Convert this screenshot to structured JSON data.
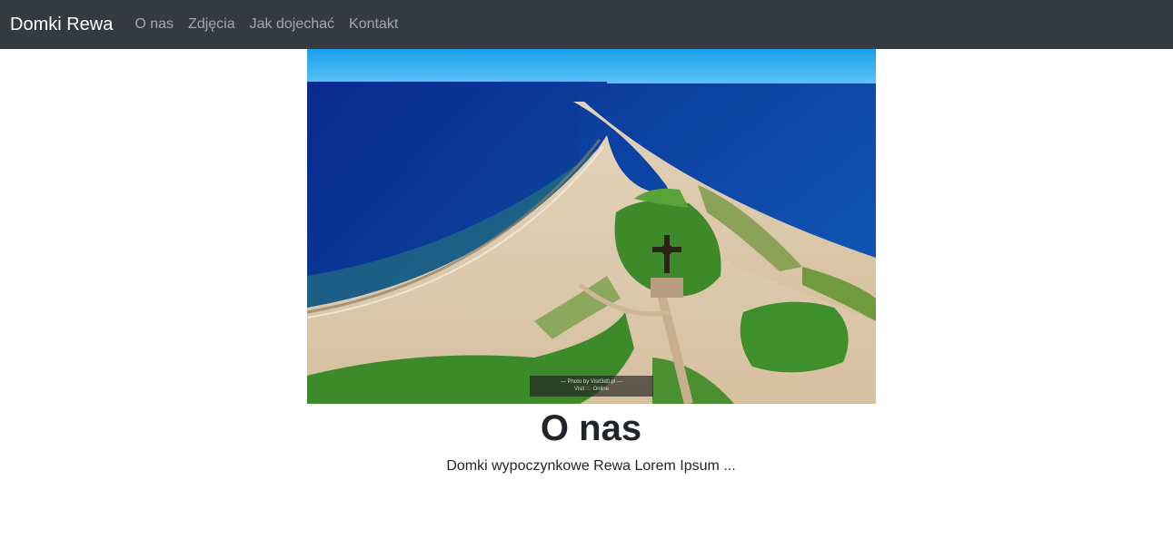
{
  "navbar": {
    "brand": "Domki Rewa",
    "items": [
      {
        "label": "O nas"
      },
      {
        "label": "Zdjęcia"
      },
      {
        "label": "Jak dojechać"
      },
      {
        "label": "Kontakt"
      }
    ]
  },
  "hero": {
    "watermark_line1": "— Photo by Visit3d0.pl —",
    "watermark_line2_a": "Visit",
    "watermark_line2_b": "3D",
    "watermark_line2_c": " Online"
  },
  "about": {
    "title": "O nas",
    "text": "Domki wypoczynkowe Rewa Lorem Ipsum ..."
  },
  "colors": {
    "navbar_bg": "#343a40",
    "brand": "#ffffff",
    "nav_link": "rgba(255,255,255,0.55)",
    "text": "#212529"
  }
}
